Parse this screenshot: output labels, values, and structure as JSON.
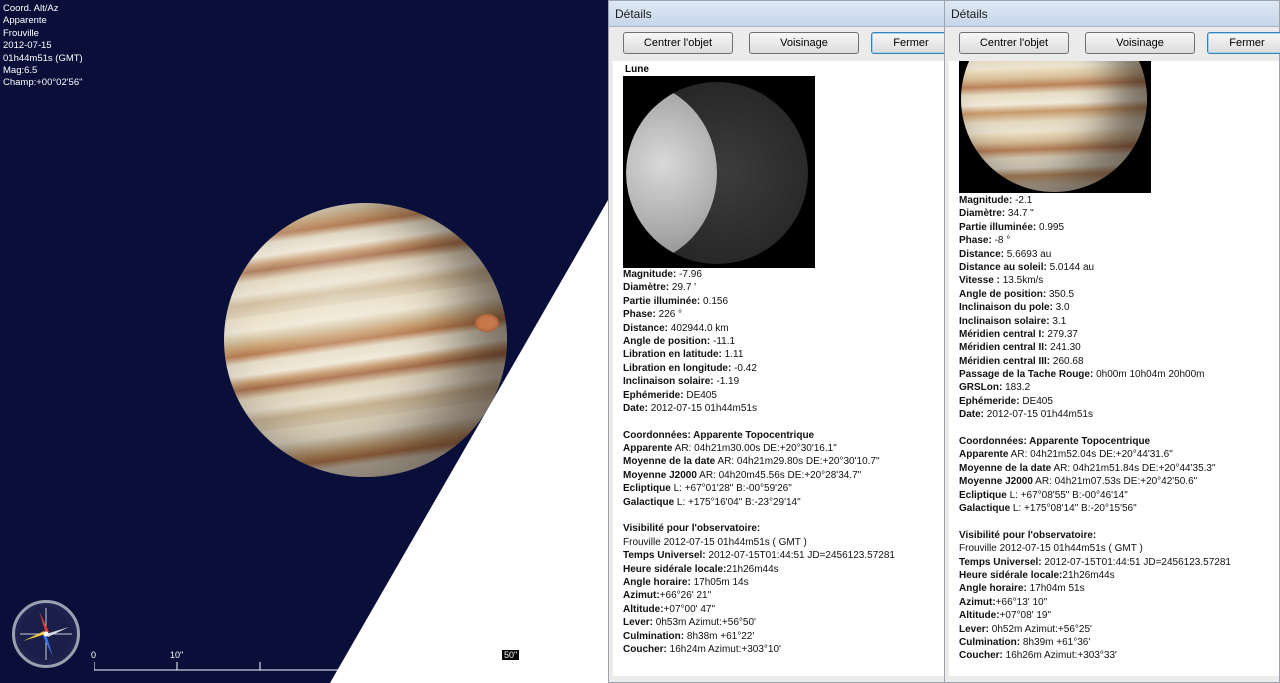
{
  "sky": {
    "info": [
      "Coord. Alt/Az",
      "Apparente",
      "Frouville",
      "2012-07-15",
      "01h44m51s (GMT)",
      "Mag:6.5",
      "Champ:+00°02'56\""
    ],
    "scale_labels": [
      "0",
      "10\"",
      "50\""
    ]
  },
  "window1": {
    "title": "Détails",
    "buttons": {
      "center": "Centrer l'objet",
      "neighborhood": "Voisinage",
      "close": "Fermer"
    },
    "object_name": "Lune",
    "props": [
      {
        "label": "Magnitude:",
        "value": " -7.96"
      },
      {
        "label": "Diamètre:",
        "value": " 29.7 '"
      },
      {
        "label": "Partie illuminée:",
        "value": " 0.156"
      },
      {
        "label": "Phase:",
        "value": " 226 °"
      },
      {
        "label": "Distance:",
        "value": " 402944.0 km"
      },
      {
        "label": "Angle de position:",
        "value": " -11.1"
      },
      {
        "label": "Libration en latitude:",
        "value": " 1.11"
      },
      {
        "label": "Libration en longitude:",
        "value": " -0.42"
      },
      {
        "label": "Inclinaison solaire:",
        "value": " -1.19"
      },
      {
        "label": "Ephémeride:",
        "value": " DE405"
      },
      {
        "label": "Date:",
        "value": " 2012-07-15 01h44m51s"
      }
    ],
    "coords_heading": "Coordonnées: Apparente Topocentrique",
    "coords": [
      {
        "label": "Apparente",
        "value": " AR: 04h21m30.00s DE:+20°30'16.1\""
      },
      {
        "label": "Moyenne de la date",
        "value": " AR: 04h21m29.80s DE:+20°30'10.7\""
      },
      {
        "label": "Moyenne J2000",
        "value": " AR: 04h20m45.56s DE:+20°28'34.7\""
      },
      {
        "label": "Ecliptique",
        "value": " L: +67°01'28\" B:-00°59'26\""
      },
      {
        "label": "Galactique",
        "value": " L: +175°16'04\" B:-23°29'14\""
      }
    ],
    "vis_heading": "Visibilité pour l'observatoire:",
    "vis_place": "Frouville 2012-07-15 01h44m51s ( GMT )",
    "vis": [
      {
        "label": "Temps Universel:",
        "value": " 2012-07-15T01:44:51 JD=2456123.57281"
      },
      {
        "label": "Heure sidérale locale:",
        "value": "21h26m44s"
      },
      {
        "label": "Angle horaire:",
        "value": " 17h05m 14s"
      },
      {
        "label": "Azimut:",
        "value": "+66°26' 21\""
      },
      {
        "label": "Altitude:",
        "value": "+07°00' 47\""
      },
      {
        "label": "Lever:",
        "value": " 0h53m Azimut:+56°50'"
      },
      {
        "label": "Culmination:",
        "value": " 8h38m +61°22'"
      },
      {
        "label": "Coucher:",
        "value": " 16h24m Azimut:+303°10'"
      }
    ]
  },
  "window2": {
    "title": "Détails",
    "buttons": {
      "center": "Centrer l'objet",
      "neighborhood": "Voisinage",
      "close": "Fermer"
    },
    "props": [
      {
        "label": "Magnitude:",
        "value": " -2.1"
      },
      {
        "label": "Diamètre:",
        "value": " 34.7 \""
      },
      {
        "label": "Partie illuminée:",
        "value": " 0.995"
      },
      {
        "label": "Phase:",
        "value": " -8 °"
      },
      {
        "label": "Distance:",
        "value": " 5.6693 au"
      },
      {
        "label": "Distance au soleil:",
        "value": " 5.0144 au"
      },
      {
        "label": "Vitesse :",
        "value": " 13.5km/s"
      },
      {
        "label": "Angle de position:",
        "value": " 350.5"
      },
      {
        "label": "Inclinaison du pole:",
        "value": " 3.0"
      },
      {
        "label": "Inclinaison solaire:",
        "value": " 3.1"
      },
      {
        "label": "Méridien central I:",
        "value": " 279.37"
      },
      {
        "label": "Méridien central II:",
        "value": " 241.30"
      },
      {
        "label": "Méridien central III:",
        "value": " 260.68"
      },
      {
        "label": "Passage de la Tache Rouge:",
        "value": " 0h00m 10h04m 20h00m"
      },
      {
        "label": "GRSLon:",
        "value": " 183.2"
      },
      {
        "label": "Ephémeride:",
        "value": " DE405"
      },
      {
        "label": "Date:",
        "value": " 2012-07-15 01h44m51s"
      }
    ],
    "coords_heading": "Coordonnées: Apparente Topocentrique",
    "coords": [
      {
        "label": "Apparente",
        "value": " AR: 04h21m52.04s DE:+20°44'31.6\""
      },
      {
        "label": "Moyenne de la date",
        "value": " AR: 04h21m51.84s DE:+20°44'35.3\""
      },
      {
        "label": "Moyenne J2000",
        "value": " AR: 04h21m07.53s DE:+20°42'50.6\""
      },
      {
        "label": "Ecliptique",
        "value": " L: +67°08'55\" B:-00°46'14\""
      },
      {
        "label": "Galactique",
        "value": " L: +175°08'14\" B:-20°15'56\""
      }
    ],
    "vis_heading": "Visibilité pour l'observatoire:",
    "vis_place": "Frouville 2012-07-15 01h44m51s ( GMT )",
    "vis": [
      {
        "label": "Temps Universel:",
        "value": " 2012-07-15T01:44:51 JD=2456123.57281"
      },
      {
        "label": "Heure sidérale locale:",
        "value": "21h26m44s"
      },
      {
        "label": "Angle horaire:",
        "value": " 17h04m 51s"
      },
      {
        "label": "Azimut:",
        "value": "+66°13' 10\""
      },
      {
        "label": "Altitude:",
        "value": "+07°08' 19\""
      },
      {
        "label": "Lever:",
        "value": " 0h52m Azimut:+56°25'"
      },
      {
        "label": "Culmination:",
        "value": " 8h39m +61°36'"
      },
      {
        "label": "Coucher:",
        "value": " 16h26m Azimut:+303°33'"
      }
    ]
  }
}
